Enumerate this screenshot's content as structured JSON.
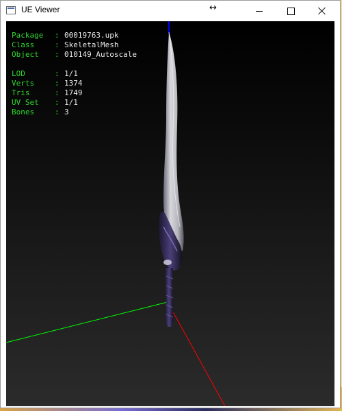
{
  "window": {
    "title": "UE Viewer"
  },
  "info": {
    "package_label": "Package",
    "package": "00019763.upk",
    "class_label": "Class",
    "class": "SkeletalMesh",
    "object_label": "Object",
    "object": "010149_Autoscale",
    "lod_label": "LOD",
    "lod": "1/1",
    "verts_label": "Verts",
    "verts": "1374",
    "tris_label": "Tris",
    "tris": "1749",
    "uvset_label": "UV Set",
    "uvset": "1/1",
    "bones_label": "Bones",
    "bones": "3",
    "separator": ":"
  },
  "colors": {
    "info_label": "#2fd52f",
    "info_value": "#e8e8e8",
    "axis_x": "#ff0000",
    "axis_y": "#00ff00",
    "axis_z": "#0000ff"
  }
}
